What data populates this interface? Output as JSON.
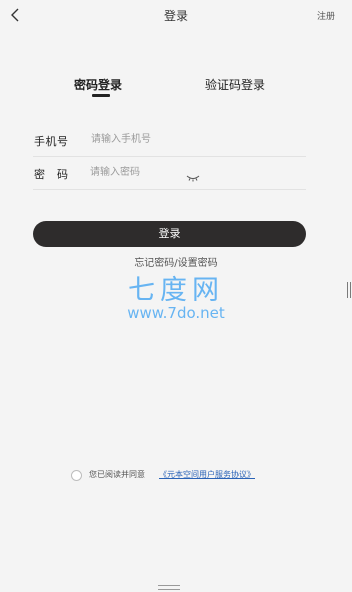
{
  "header": {
    "title": "登录",
    "register_label": "注册"
  },
  "tabs": {
    "password_login": "密码登录",
    "sms_login": "验证码登录"
  },
  "form": {
    "phone_label": "手机号",
    "phone_placeholder": "请输入手机号",
    "password_label": "密　码",
    "password_placeholder": "请输入密码"
  },
  "actions": {
    "login_label": "登录",
    "forgot_label": "忘记密码/设置密码"
  },
  "watermark": {
    "brand": "七度网",
    "url": "www.7do.net"
  },
  "agreement": {
    "text": "您已阅读并同意",
    "link": "《元本空间用户服务协议》"
  },
  "colors": {
    "button": "#2e2c2c",
    "link": "#2a63b7",
    "watermark": "#58aef2"
  }
}
